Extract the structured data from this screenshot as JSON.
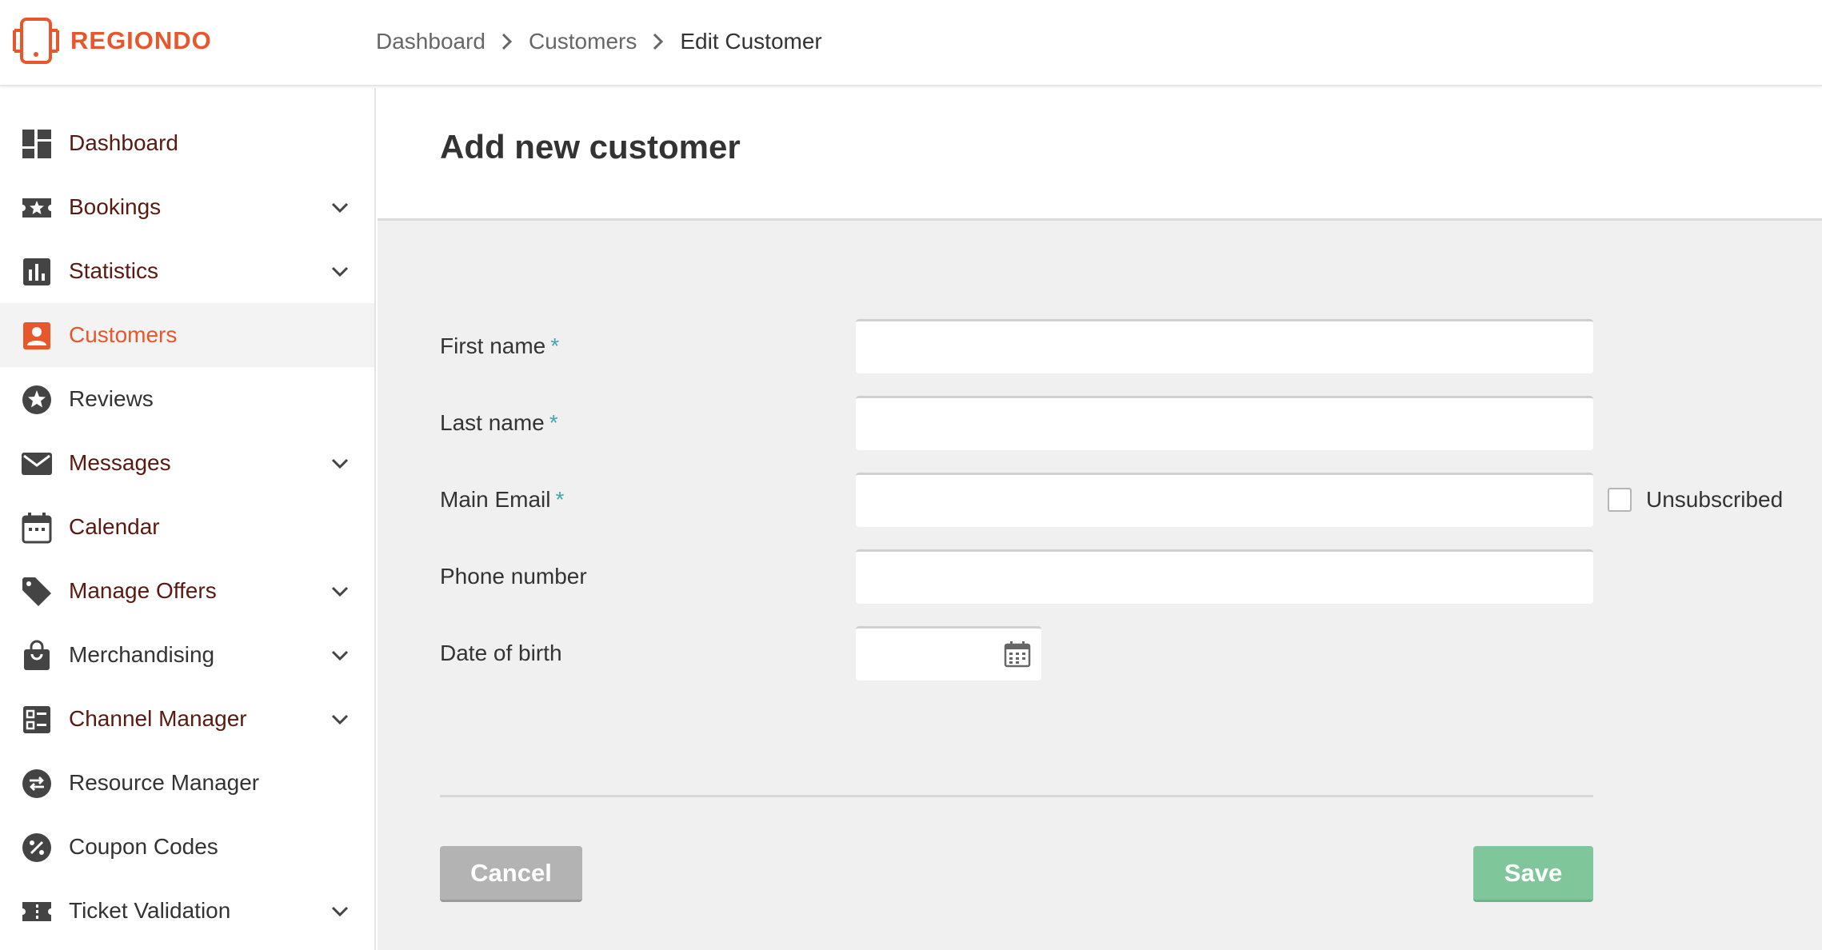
{
  "brand": {
    "name": "REGIONDO",
    "color": "#e8572b"
  },
  "breadcrumb": [
    "Dashboard",
    "Customers",
    "Edit Customer"
  ],
  "sidebar": {
    "items": [
      {
        "label": "Dashboard",
        "icon": "dashboard-icon",
        "expandable": false
      },
      {
        "label": "Bookings",
        "icon": "ticket-star-icon",
        "expandable": true
      },
      {
        "label": "Statistics",
        "icon": "bar-chart-icon",
        "expandable": true
      },
      {
        "label": "Customers",
        "icon": "customer-icon",
        "expandable": false,
        "active": true
      },
      {
        "label": "Reviews",
        "icon": "star-circle-icon",
        "expandable": false
      },
      {
        "label": "Messages",
        "icon": "envelope-icon",
        "expandable": true
      },
      {
        "label": "Calendar",
        "icon": "calendar-icon",
        "expandable": false
      },
      {
        "label": "Manage Offers",
        "icon": "tag-icon",
        "expandable": true
      },
      {
        "label": "Merchandising",
        "icon": "shopping-bag-icon",
        "expandable": true
      },
      {
        "label": "Channel Manager",
        "icon": "channel-icon",
        "expandable": true
      },
      {
        "label": "Resource Manager",
        "icon": "swap-icon",
        "expandable": false
      },
      {
        "label": "Coupon Codes",
        "icon": "percent-icon",
        "expandable": false
      },
      {
        "label": "Ticket Validation",
        "icon": "ticket-icon",
        "expandable": true
      }
    ]
  },
  "main": {
    "title": "Add new customer",
    "form": {
      "first_name": {
        "label": "First name",
        "required": "*",
        "value": ""
      },
      "last_name": {
        "label": "Last name",
        "required": "*",
        "value": ""
      },
      "email": {
        "label": "Main Email",
        "required": "*",
        "value": ""
      },
      "phone": {
        "label": "Phone number",
        "value": ""
      },
      "dob": {
        "label": "Date of birth",
        "value": ""
      },
      "unsubscribed_label": "Unsubscribed"
    },
    "cancel_label": "Cancel",
    "save_label": "Save"
  }
}
